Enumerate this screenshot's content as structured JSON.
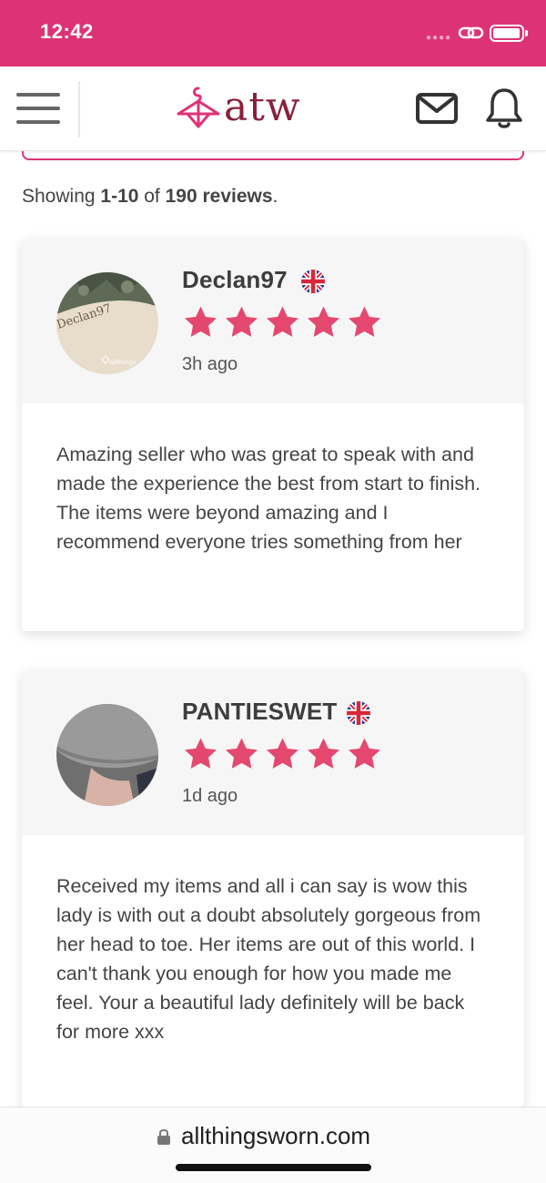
{
  "status_bar": {
    "time": "12:42",
    "background": "#dd3376"
  },
  "header": {
    "brand": "atw",
    "brand_color": "#8a1f3c",
    "accent_color": "#dd3376",
    "icons": [
      "menu-icon",
      "hanger-logo-icon",
      "mail-icon",
      "bell-icon"
    ]
  },
  "results": {
    "prefix": "Showing ",
    "range": "1-10",
    "middle": " of ",
    "total": "190 reviews",
    "suffix": "."
  },
  "reviews": [
    {
      "name": "Declan97",
      "flag": "uk-flag-icon",
      "stars": 5,
      "time_ago": "3h ago",
      "avatar_text": "Declan97",
      "avatar_watermark": "allthings",
      "text": "Amazing seller who was great to speak with and made the experience the best from start to finish. The items were beyond amazing and I recommend everyone tries something from her"
    },
    {
      "name": "PANTIESWET",
      "flag": "uk-flag-icon",
      "stars": 5,
      "time_ago": "1d ago",
      "text": "Received my items and all i can say is wow this lady is with out a doubt absolutely gorgeous from her head to toe. Her items are out of this world. I can't thank you enough for how you made me feel. Your a beautiful lady definitely will be back for more xxx"
    }
  ],
  "url_bar": {
    "url": "allthingsworn.com"
  },
  "star_color": "#e5486e"
}
